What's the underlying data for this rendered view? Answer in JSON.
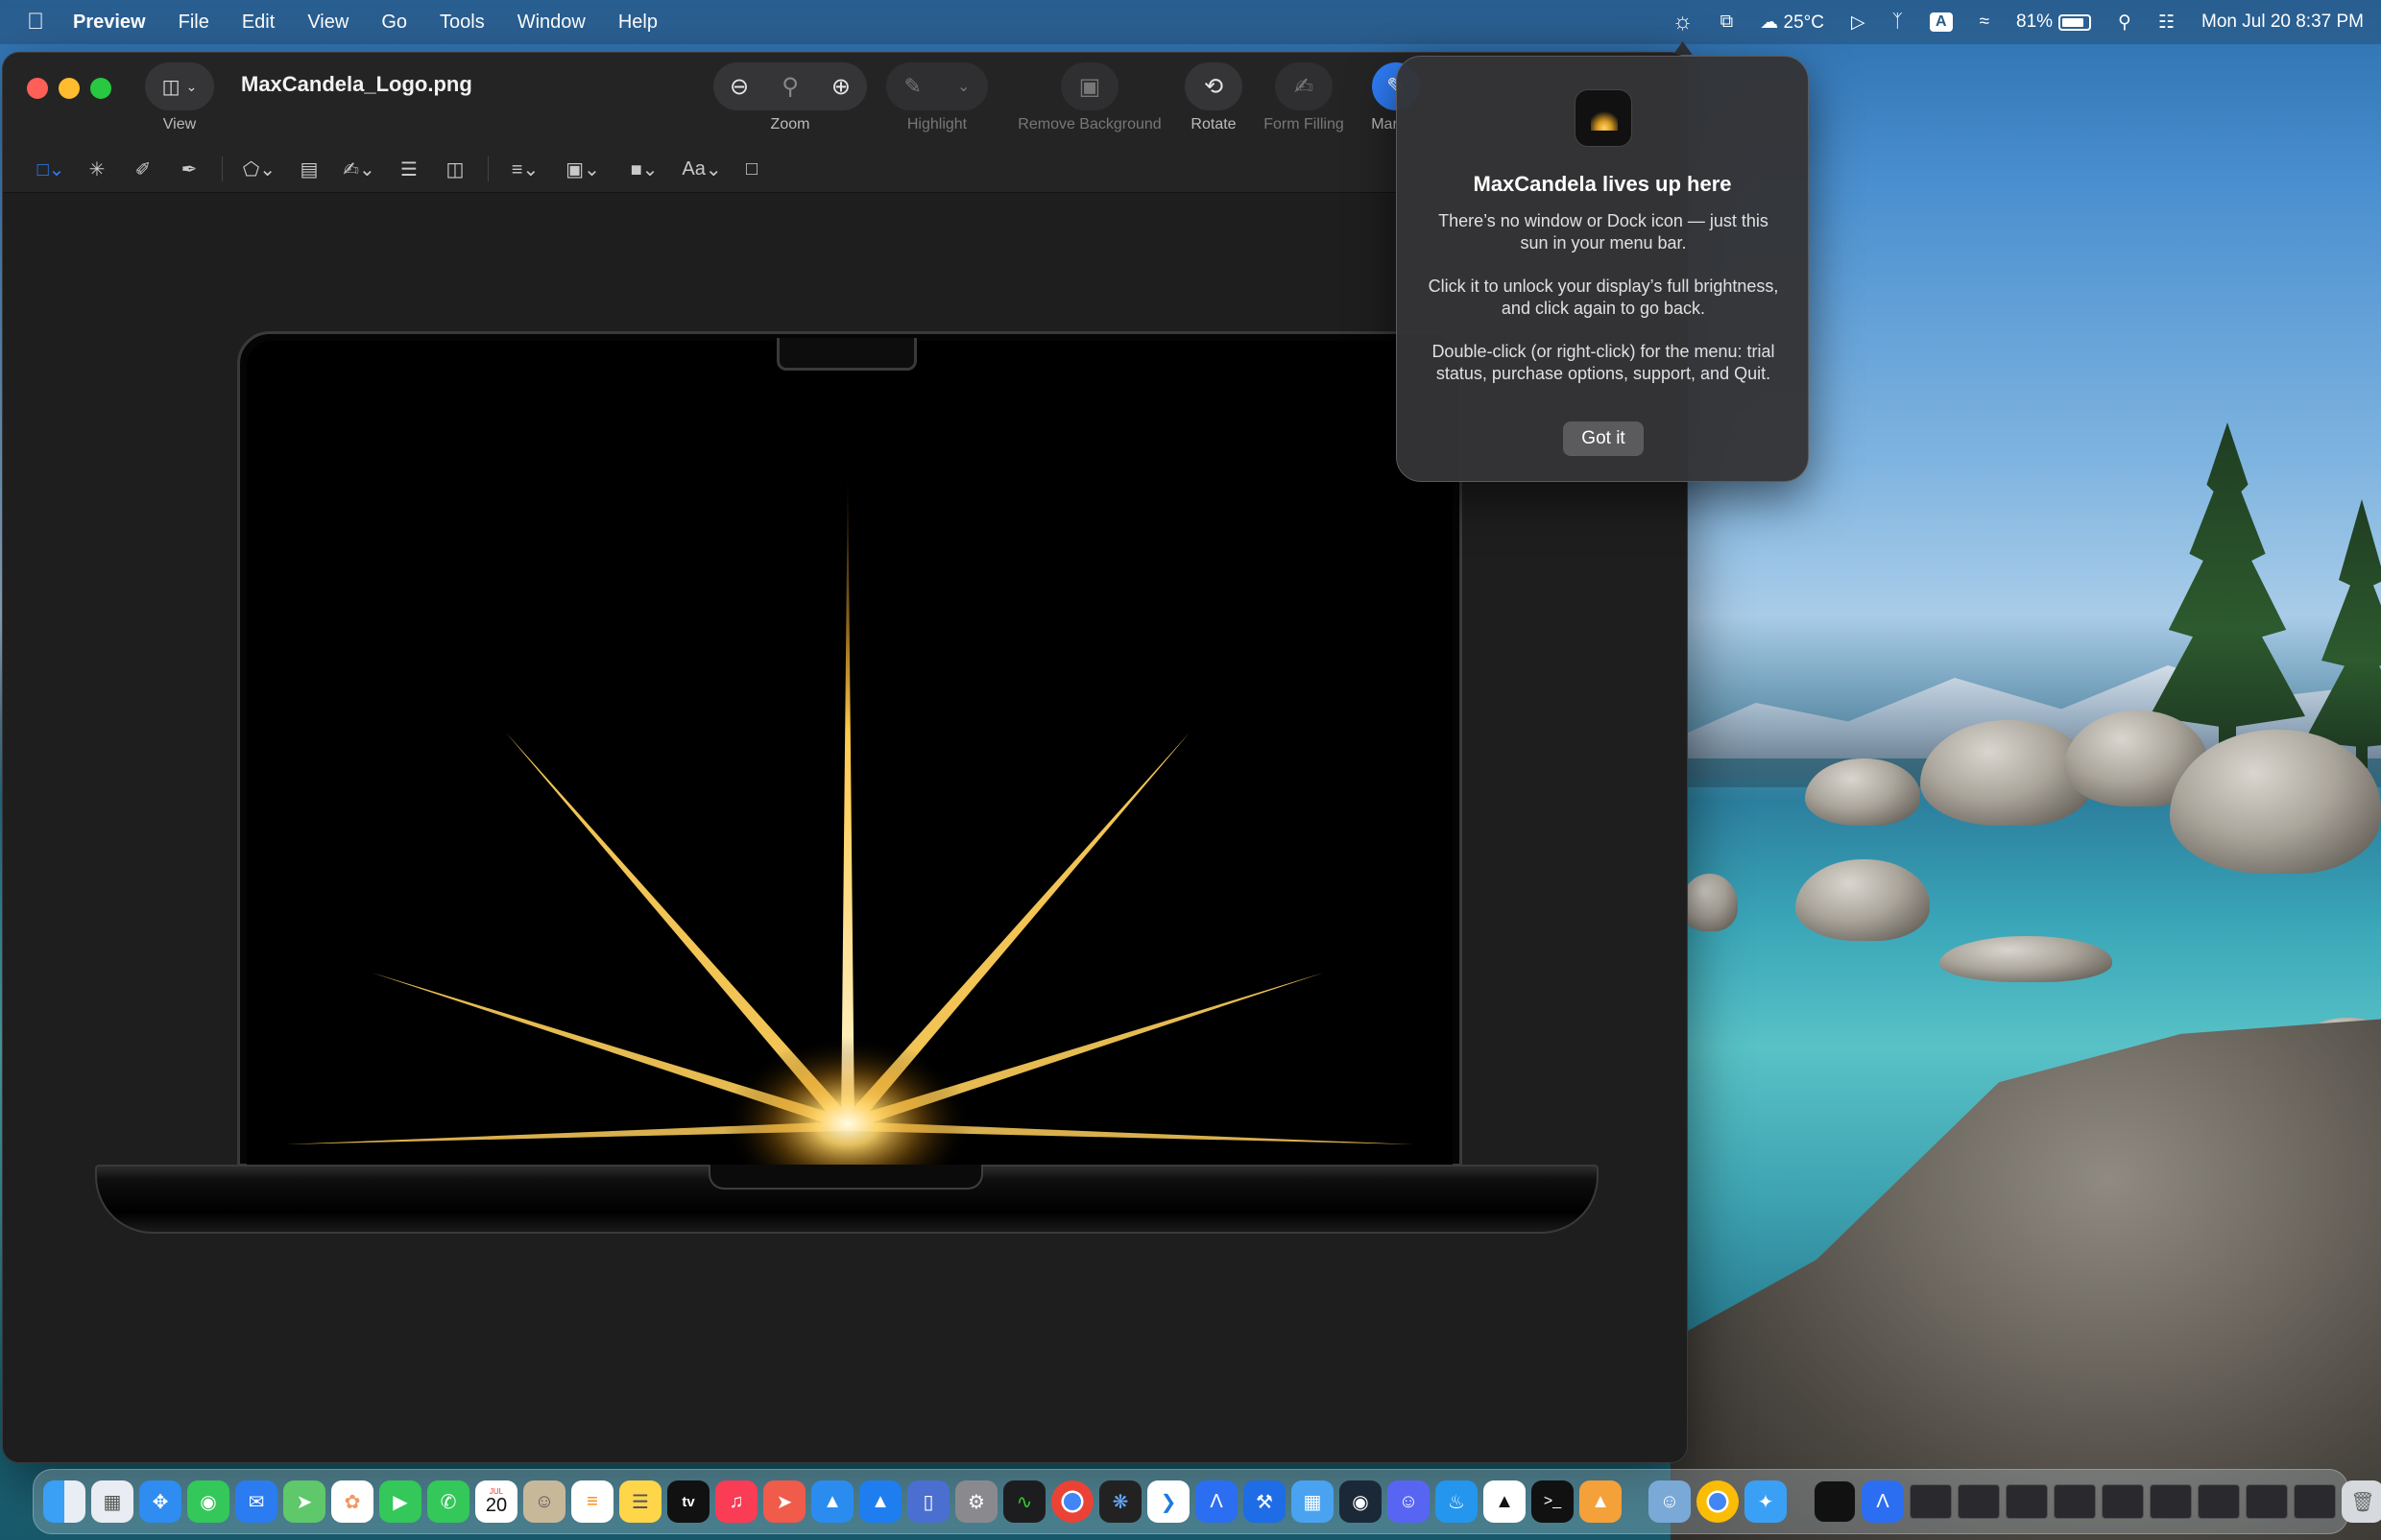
{
  "menubar": {
    "app_name": "Preview",
    "menus": [
      "File",
      "Edit",
      "View",
      "Go",
      "Tools",
      "Window",
      "Help"
    ],
    "weather": "25°C",
    "input_source": "A",
    "battery": "81%",
    "datetime": "Mon Jul 20  8:37 PM"
  },
  "window": {
    "title": "MaxCandela_Logo.png",
    "toolbar": {
      "view_label": "View",
      "zoom_label": "Zoom",
      "highlight_label": "Highlight",
      "remove_background_label": "Remove Background",
      "rotate_label": "Rotate",
      "form_filling_label": "Form Filling",
      "markup_label": "Mar"
    },
    "markup_tools": {
      "text_style_label": "Aa"
    }
  },
  "popover": {
    "title": "MaxCandela lives up here",
    "paragraph_1": "There’s no window or Dock icon — just this sun in your menu bar.",
    "paragraph_2": "Click it to unlock your display’s full brightness, and click again to go back.",
    "paragraph_3": "Double-click (or right-click) for the menu: trial status, purchase options, support, and Quit.",
    "button_label": "Got it"
  },
  "dock": {
    "calendar_month": "JUL",
    "calendar_day": "20",
    "tv_label": "tv",
    "apps": [
      "finder",
      "launchpad",
      "safari",
      "messages",
      "mail",
      "maps",
      "photos",
      "facetime",
      "phone",
      "calendar",
      "contacts",
      "reminders",
      "notes",
      "tv",
      "music",
      "rocket",
      "app-store",
      "xcode-instruments",
      "simulator",
      "system-settings",
      "activity-monitor",
      "chrome",
      "davinci-resolve",
      "vscode",
      "translator",
      "xcode",
      "files",
      "steam",
      "discord",
      "docker",
      "inkscape",
      "terminal",
      "vlc",
      "finder-2",
      "chrome-2",
      "testflight"
    ]
  },
  "colors": {
    "accent": "#2f7cf6",
    "close": "#ff5f57",
    "minimize": "#febc2e",
    "zoom": "#28c840",
    "sun_glow": "#ffcf5a"
  }
}
